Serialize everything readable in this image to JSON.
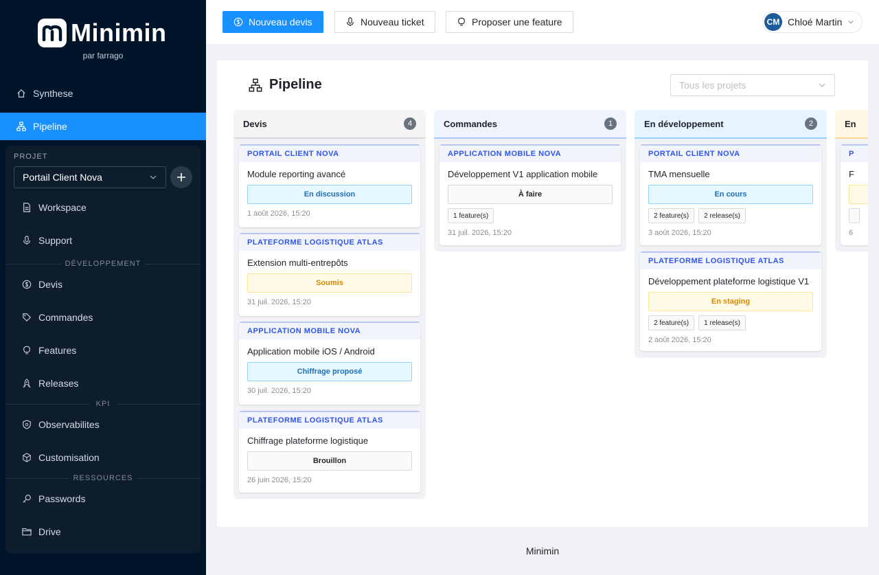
{
  "brand": {
    "name": "Minimin",
    "subtitle": "par farrago"
  },
  "nav": {
    "top": [
      {
        "label": "Synthese",
        "icon": "home-icon"
      },
      {
        "label": "Pipeline",
        "icon": "sitemap-icon",
        "active": true
      }
    ],
    "project_label": "PROJET",
    "project_value": "Portail Client Nova",
    "items_main": [
      {
        "label": "Workspace",
        "icon": "file-icon"
      },
      {
        "label": "Support",
        "icon": "microphone-icon"
      }
    ],
    "section_dev": "DÉVELOPPEMENT",
    "items_dev": [
      {
        "label": "Devis",
        "icon": "dollar-icon"
      },
      {
        "label": "Commandes",
        "icon": "tag-icon"
      },
      {
        "label": "Features",
        "icon": "bulb-icon"
      },
      {
        "label": "Releases",
        "icon": "rocket-icon"
      }
    ],
    "section_kpi": "KPI",
    "items_kpi": [
      {
        "label": "Observabilites",
        "icon": "shield-icon"
      },
      {
        "label": "Customisation",
        "icon": "cube-icon"
      }
    ],
    "section_res": "RESSOURCES",
    "items_res": [
      {
        "label": "Passwords",
        "icon": "key-icon"
      },
      {
        "label": "Drive",
        "icon": "folder-icon"
      }
    ]
  },
  "topbar": {
    "new_quote": "Nouveau devis",
    "new_ticket": "Nouveau ticket",
    "propose_feature": "Proposer une feature",
    "user_initials": "CM",
    "user_name": "Chloé Martin"
  },
  "page": {
    "title": "Pipeline",
    "filter_placeholder": "Tous les projets"
  },
  "columns": [
    {
      "title": "Devis",
      "count": "4",
      "head_bg": "#f5f5f5",
      "head_border": "#d9d9d9",
      "cards": [
        {
          "project": "PORTAIL CLIENT NOVA",
          "title": "Module reporting avancé",
          "status": "En discussion",
          "status_style": "blue",
          "tags": [],
          "date": "1 août 2026, 15:20"
        },
        {
          "project": "PLATEFORME LOGISTIQUE ATLAS",
          "title": "Extension multi-entrepôts",
          "status": "Soumis",
          "status_style": "orange",
          "tags": [],
          "date": "31 juil. 2026, 15:20"
        },
        {
          "project": "APPLICATION MOBILE NOVA",
          "title": "Application mobile iOS / Android",
          "status": "Chiffrage proposé",
          "status_style": "blue",
          "tags": [],
          "date": "30 juil. 2026, 15:20"
        },
        {
          "project": "PLATEFORME LOGISTIQUE ATLAS",
          "title": "Chiffrage plateforme logistique",
          "status": "Brouillon",
          "status_style": "grey",
          "tags": [],
          "date": "26 juin 2026, 15:20"
        }
      ]
    },
    {
      "title": "Commandes",
      "count": "1",
      "head_bg": "#eef3fd",
      "head_border": "#adc6ff",
      "cards": [
        {
          "project": "APPLICATION MOBILE NOVA",
          "title": "Développement V1 application mobile",
          "status": "À faire",
          "status_style": "grey",
          "tags": [
            "1 feature(s)"
          ],
          "date": "31 juil. 2026, 15:20"
        }
      ]
    },
    {
      "title": "En développement",
      "count": "2",
      "head_bg": "#e6f4ff",
      "head_border": "#91d5ff",
      "cards": [
        {
          "project": "PORTAIL CLIENT NOVA",
          "title": "TMA mensuelle",
          "status": "En cours",
          "status_style": "blue",
          "tags": [
            "2 feature(s)",
            "2 release(s)"
          ],
          "date": "3 août 2026, 15:20"
        },
        {
          "project": "PLATEFORME LOGISTIQUE ATLAS",
          "title": "Développement plateforme logistique V1",
          "status": "En staging",
          "status_style": "orange",
          "tags": [
            "2 feature(s)",
            "1 release(s)"
          ],
          "date": "2 août 2026, 15:20"
        }
      ]
    },
    {
      "title": "En",
      "count": "",
      "head_bg": "#fff7e6",
      "head_border": "#ffd591",
      "cards": [
        {
          "project": "P",
          "title": "F",
          "status": "",
          "status_style": "orange",
          "tags": [
            ""
          ],
          "date": "6"
        }
      ]
    }
  ],
  "footer": "Minimin"
}
